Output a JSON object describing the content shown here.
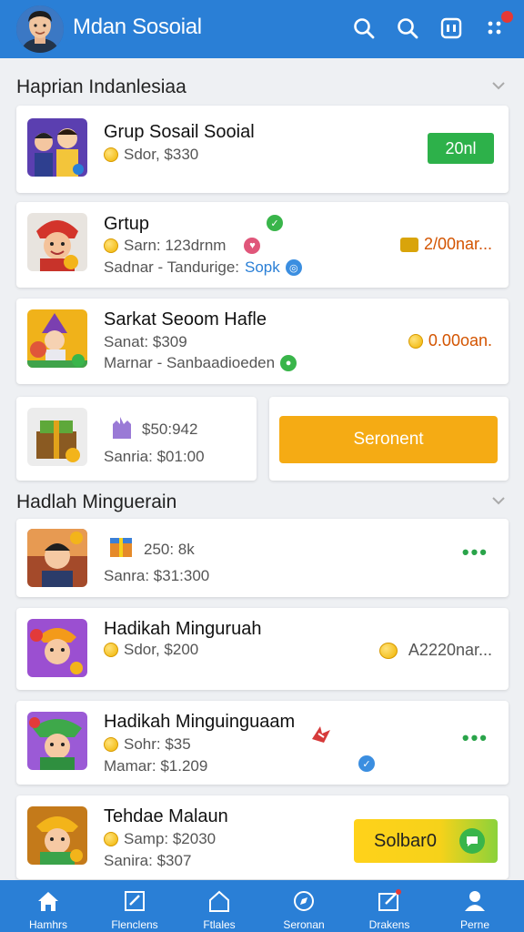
{
  "app": {
    "title": "Mdan Sosoial"
  },
  "header_icons": [
    "search-icon",
    "search-icon",
    "chat-icon",
    "apps-icon"
  ],
  "colors": {
    "primary": "#2a7fd6",
    "green": "#2db14a",
    "orange": "#f5ab14",
    "accent_text": "#d35400"
  },
  "section1": {
    "title": "Haprian Indanlesiaa",
    "cards": [
      {
        "title": "Grup Sosail Sooial",
        "line1": "Sdor, $330",
        "action": "20nl"
      },
      {
        "title": "Grtup",
        "line1": "Sarn: 123drnm",
        "line2": "Sadnar  -  Tandurige:",
        "line2_link": "Sopk",
        "right": "2/00nar..."
      },
      {
        "title": "Sarkat Seoom Hafle",
        "line1": "Sanat: $309",
        "line2": "Marnar  -  Sanbaadioeden",
        "right": "0.00oan."
      },
      {
        "line1": "$50:942",
        "line2": "Sanria: $01:00",
        "button": "Seronent"
      }
    ]
  },
  "section2": {
    "title": "Hadlah Minguerain",
    "cards": [
      {
        "line1": "250: 8k",
        "line2": "Sanra: $31:300",
        "more": "•••"
      },
      {
        "title": "Hadikah Minguruah",
        "line1": "Sdor, $200",
        "right": "A2220nar..."
      },
      {
        "title": "Hadikah  Minguinguaam",
        "line1": "Sohr: $35",
        "line2": "Mamar: $1.209",
        "more": "•••"
      },
      {
        "title": "Tehdae Malaun",
        "line1": "Samp: $2030",
        "line2": "Sanira: $307",
        "button": "Solbar0"
      }
    ]
  },
  "bottom_nav": [
    {
      "label": "Hamhrs",
      "icon": "home-icon"
    },
    {
      "label": "Flenclens",
      "icon": "edit-icon"
    },
    {
      "label": "Ftlales",
      "icon": "house-outline-icon"
    },
    {
      "label": "Seronan",
      "icon": "compass-icon"
    },
    {
      "label": "Drakens",
      "icon": "edit-box-icon"
    },
    {
      "label": "Perne",
      "icon": "person-icon"
    }
  ]
}
